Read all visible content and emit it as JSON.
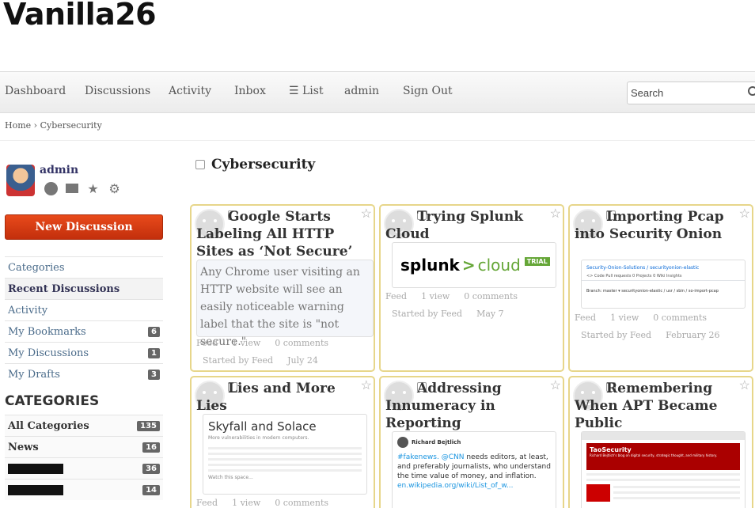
{
  "site": {
    "title": "Vanilla26"
  },
  "nav": {
    "items": [
      "Dashboard",
      "Discussions",
      "Activity",
      "Inbox",
      "☰ List",
      "admin",
      "Sign Out"
    ],
    "search_placeholder": "Search"
  },
  "breadcrumb": {
    "home": "Home",
    "sep": "›",
    "current": "Cybersecurity"
  },
  "user": {
    "name": "admin"
  },
  "sidebar": {
    "new_discussion": "New Discussion",
    "items": [
      {
        "label": "Categories",
        "count": null
      },
      {
        "label": "Recent Discussions",
        "count": null
      },
      {
        "label": "Activity",
        "count": null
      },
      {
        "label": "My Bookmarks",
        "count": "6"
      },
      {
        "label": "My Discussions",
        "count": "1"
      },
      {
        "label": "My Drafts",
        "count": "3"
      }
    ],
    "categories_heading": "CATEGORIES",
    "categories": [
      {
        "label": "All Categories",
        "count": "135"
      },
      {
        "label": "News",
        "count": "16"
      },
      {
        "label": "",
        "count": "36"
      },
      {
        "label": "",
        "count": "14"
      }
    ]
  },
  "page": {
    "title": "Cybersecurity"
  },
  "tiles": [
    {
      "title": "Google Starts Labeling All HTTP Sites as ‘Not Secure’",
      "excerpt": "Any Chrome user visiting an HTTP website will see an easily noticeable warning label that the site is \"not secure.\"",
      "source": "Feed",
      "views": "1 view",
      "comments": "0 comments",
      "started_by": "Started by Feed",
      "date": "July 24"
    },
    {
      "title": "Trying Splunk Cloud",
      "embed": {
        "logo_a": "splunk",
        "logo_gt": ">",
        "logo_b": "cloud",
        "badge": "TRIAL"
      },
      "source": "Feed",
      "views": "1 view",
      "comments": "0 comments",
      "started_by": "Started by Feed",
      "date": "May 7"
    },
    {
      "title": "Importing Pcap into Security Onion",
      "embed": {
        "repo": "Security-Onion-Solutions / securityonion-elastic",
        "tabs": "<> Code   Pull requests 0   Projects 0   Wiki   Insights",
        "path": "Branch: master ▾   securityonion-elastic / usr / sbin / so-import-pcap"
      },
      "source": "Feed",
      "views": "1 view",
      "comments": "0 comments",
      "started_by": "Started by Feed",
      "date": "February 26"
    },
    {
      "title": "Lies and More Lies",
      "embed": {
        "heading": "Skyfall and Solace",
        "sub": "More vulnerabilities in modern computers.",
        "footer": "Watch this space..."
      },
      "source": "Feed",
      "views": "1 view",
      "comments": "0 comments"
    },
    {
      "title": "Addressing Innumeracy in Reporting",
      "embed": {
        "author": "Richard Bejtlich",
        "tag1": "#fakenews.",
        "tag2": "@CNN",
        "text": "needs editors, at least, and preferably journalists, who understand the time value of money, and inflation.",
        "link": "en.wikipedia.org/wiki/List_of_w..."
      }
    },
    {
      "title": "Remembering When APT Became Public",
      "embed": {
        "banner": "TaoSecurity",
        "sub": "Richard Bejtlich's blog on digital security, strategic thought, and military history."
      }
    }
  ]
}
